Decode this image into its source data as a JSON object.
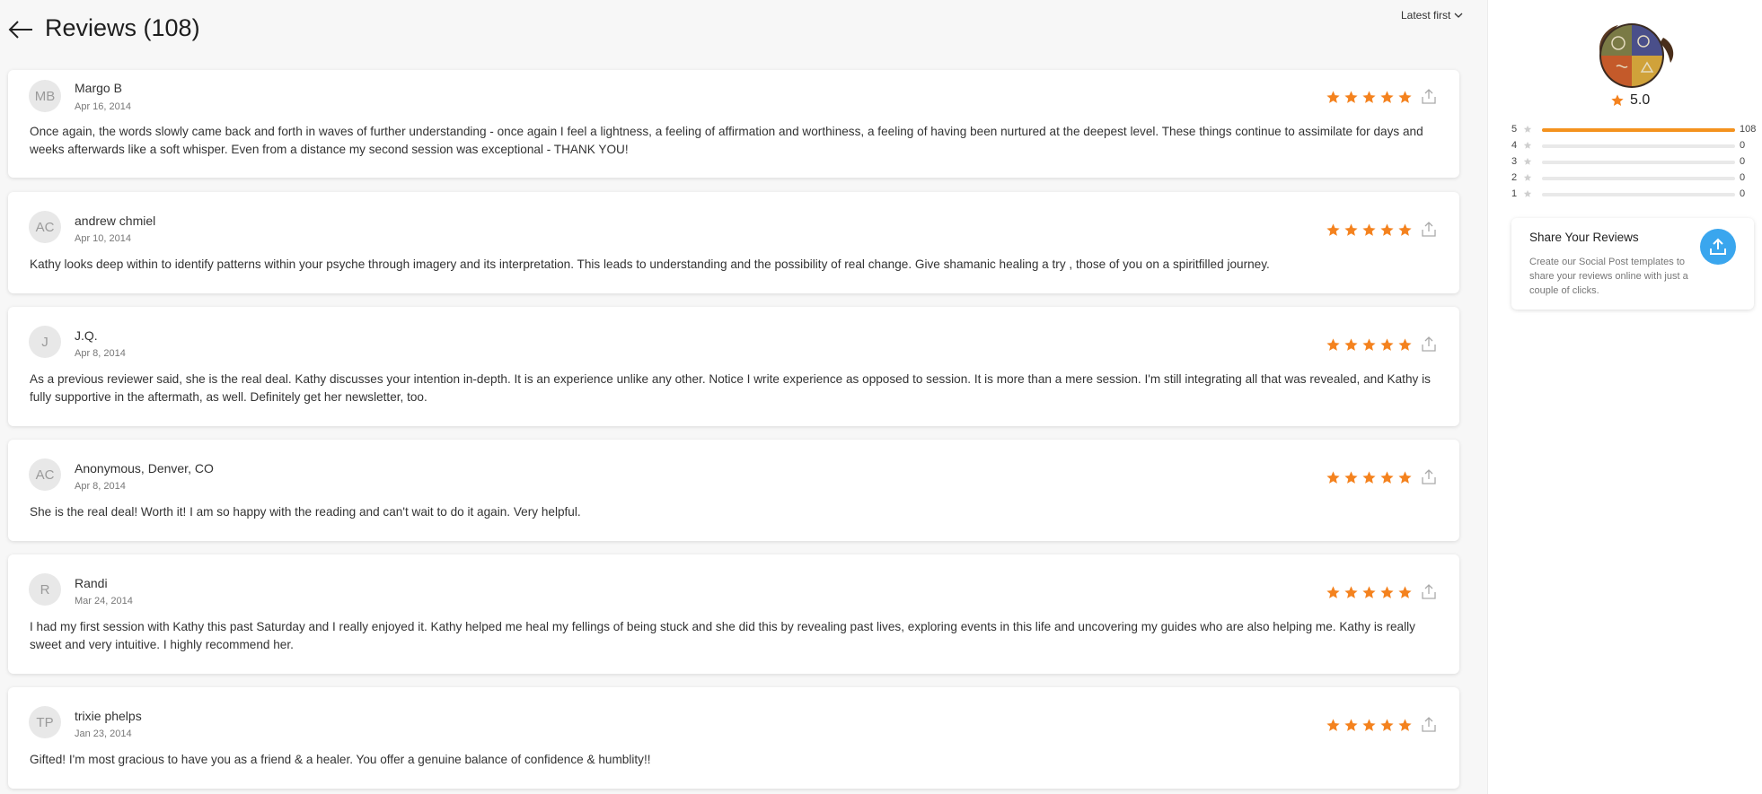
{
  "header": {
    "title": "Reviews (108)",
    "sort_label": "Latest first"
  },
  "reviews": [
    {
      "initials": "MB",
      "name": "Margo B",
      "date": "Apr 16, 2014",
      "rating": 5,
      "text": "Once again, the words slowly came back and forth in waves of further understanding - once again I feel a lightness, a feeling of affirmation and worthiness, a feeling of having been nurtured at the deepest level. These things continue to assimilate for days and weeks afterwards like a soft whisper. Even from a distance my second session was exceptional - THANK YOU!"
    },
    {
      "initials": "AC",
      "name": "andrew chmiel",
      "date": "Apr 10, 2014",
      "rating": 5,
      "text": "Kathy looks deep within to identify patterns within your psyche through imagery and its interpretation. This leads to understanding and the possibility of real change. Give shamanic healing a try , those of you on a spiritfilled journey."
    },
    {
      "initials": "J",
      "name": "J.Q.",
      "date": "Apr 8, 2014",
      "rating": 5,
      "text": "As a previous reviewer said, she is the real deal. Kathy discusses your intention in-depth. It is an experience unlike any other. Notice I write experience as opposed to session. It is more than a mere session. I'm still integrating all that was revealed, and Kathy is fully supportive in the aftermath, as well. Definitely get her newsletter, too."
    },
    {
      "initials": "AC",
      "name": "Anonymous, Denver, CO",
      "date": "Apr 8, 2014",
      "rating": 5,
      "text": "She is the real deal! Worth it! I am so happy with the reading and can't wait to do it again. Very helpful."
    },
    {
      "initials": "R",
      "name": "Randi",
      "date": "Mar 24, 2014",
      "rating": 5,
      "text": "I had my first session with Kathy this past Saturday and I really enjoyed it. Kathy helped me heal my fellings of being stuck and she did this by revealing past lives, exploring events in this life and uncovering my guides who are also helping me. Kathy is really sweet and very intuitive. I highly recommend her."
    },
    {
      "initials": "TP",
      "name": "trixie phelps",
      "date": "Jan 23, 2014",
      "rating": 5,
      "text": "Gifted! I'm most gracious to have you as a friend & a healer. You offer a genuine balance of confidence & humblity!!"
    }
  ],
  "summary": {
    "average": "5.0",
    "breakdown": [
      {
        "stars": "5",
        "count": "108",
        "fraction": 1.0
      },
      {
        "stars": "4",
        "count": "0",
        "fraction": 0
      },
      {
        "stars": "3",
        "count": "0",
        "fraction": 0
      },
      {
        "stars": "2",
        "count": "0",
        "fraction": 0
      },
      {
        "stars": "1",
        "count": "0",
        "fraction": 0
      }
    ]
  },
  "share": {
    "title": "Share Your Reviews",
    "description": "Create our Social Post templates to share your reviews online with just a couple of clicks."
  },
  "colors": {
    "star": "#f4821e",
    "bar_fill": "#f4921e",
    "share_button": "#3aa6ee"
  }
}
